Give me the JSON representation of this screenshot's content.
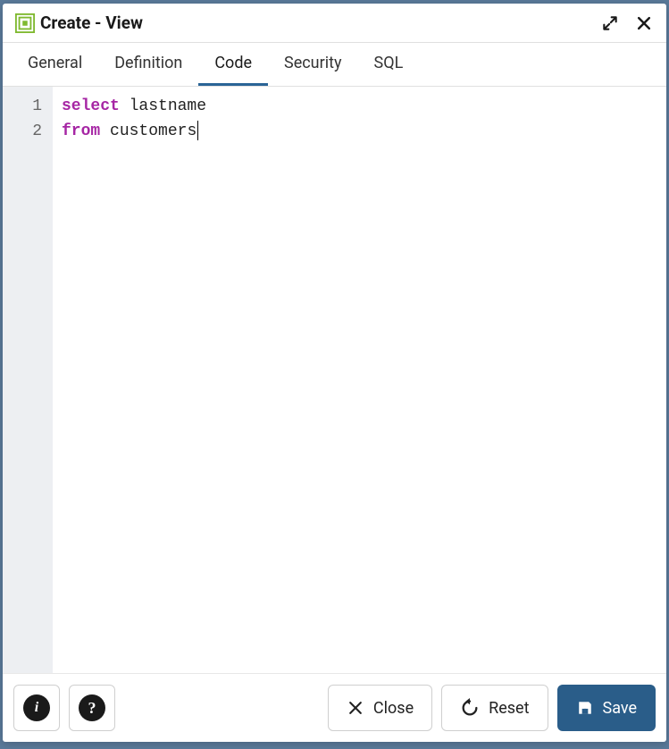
{
  "dialog": {
    "title": "Create - View"
  },
  "tabs": {
    "items": [
      {
        "label": "General",
        "active": false
      },
      {
        "label": "Definition",
        "active": false
      },
      {
        "label": "Code",
        "active": true
      },
      {
        "label": "Security",
        "active": false
      },
      {
        "label": "SQL",
        "active": false
      }
    ]
  },
  "editor": {
    "lines": [
      {
        "number": "1",
        "tokens": [
          {
            "t": "kw",
            "v": "select"
          },
          {
            "t": "sp",
            "v": " "
          },
          {
            "t": "ident",
            "v": "lastname"
          }
        ]
      },
      {
        "number": "2",
        "tokens": [
          {
            "t": "kw",
            "v": "from"
          },
          {
            "t": "sp",
            "v": " "
          },
          {
            "t": "ident",
            "v": "customers"
          }
        ],
        "cursor": true
      }
    ]
  },
  "footer": {
    "close_label": "Close",
    "reset_label": "Reset",
    "save_label": "Save"
  }
}
